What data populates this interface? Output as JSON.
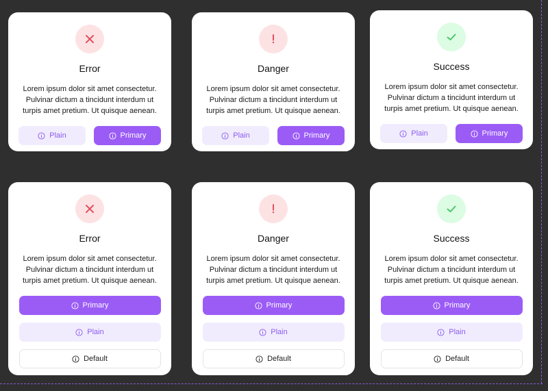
{
  "colors": {
    "background": "#2f2f2f",
    "card": "#ffffff",
    "accent": "#9b5cf6",
    "plain_bg": "#f1ecfd",
    "error_icon": "#e04f5f",
    "success_icon": "#4cc66a"
  },
  "description": "Lorem ipsum dolor sit amet consectetur. Pulvinar dictum a tincidunt interdum ut turpis amet pretium. Ut quisque aenean.",
  "desc_lines": [
    "Lorem ipsum dolor sit amet consectetur.",
    "Pulvinar dictum a tincidunt interdum ut",
    "turpis amet pretium. Ut quisque aenean."
  ],
  "row1": [
    {
      "title": "Error",
      "icon": "x-icon",
      "buttons": {
        "plain": "Plain",
        "primary": "Primary"
      }
    },
    {
      "title": "Danger",
      "icon": "exclamation-icon",
      "buttons": {
        "plain": "Plain",
        "primary": "Primary"
      }
    },
    {
      "title": "Success",
      "icon": "check-icon",
      "buttons": {
        "plain": "Plain",
        "primary": "Primary"
      }
    }
  ],
  "row2": [
    {
      "title": "Error",
      "icon": "x-icon",
      "buttons": {
        "primary": "Primary",
        "plain": "Plain",
        "default": "Default"
      }
    },
    {
      "title": "Danger",
      "icon": "exclamation-icon",
      "buttons": {
        "primary": "Primary",
        "plain": "Plain",
        "default": "Default"
      }
    },
    {
      "title": "Success",
      "icon": "check-icon",
      "buttons": {
        "primary": "Primary",
        "plain": "Plain",
        "default": "Default"
      }
    }
  ]
}
